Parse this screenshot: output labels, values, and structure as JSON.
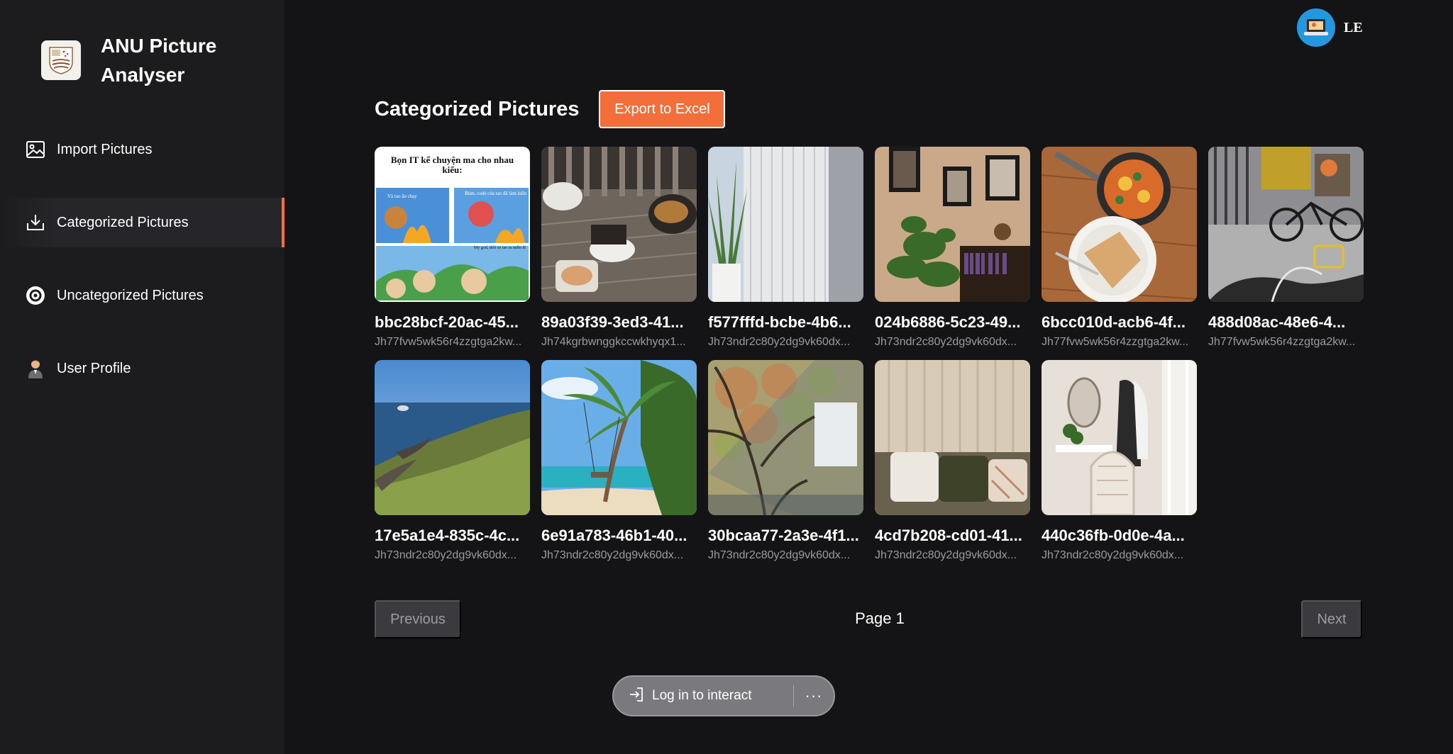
{
  "app": {
    "title": "ANU Picture Analyser"
  },
  "sidebar": {
    "items": [
      {
        "label": "Import Pictures",
        "icon": "image-icon"
      },
      {
        "label": "Categorized Pictures",
        "icon": "download-icon"
      },
      {
        "label": "Uncategorized Pictures",
        "icon": "circle-record-icon"
      },
      {
        "label": "User Profile",
        "icon": "user-icon"
      }
    ]
  },
  "user": {
    "initials": "LE"
  },
  "main": {
    "title": "Categorized Pictures",
    "export_label": "Export to Excel"
  },
  "pictures": [
    {
      "name": "bbc28bcf-20ac-45...",
      "sub": "Jh77fvw5wk56r4zzgtga2kw...",
      "comic_title": "Bọn IT kể chuyện ma cho nhau kiểu:",
      "comic_left": "Và tao ăn chạy",
      "comic_right": "Bùm, code của tao đã làm luôn",
      "comic_bottom": "My god, thôi xe tao ra miền đi"
    },
    {
      "name": "89a03f39-3ed3-41...",
      "sub": "Jh74kgrbwnggkccwkhyqx1..."
    },
    {
      "name": "f577fffd-bcbe-4b6...",
      "sub": "Jh73ndr2c80y2dg9vk60dx..."
    },
    {
      "name": "024b6886-5c23-49...",
      "sub": "Jh73ndr2c80y2dg9vk60dx..."
    },
    {
      "name": "6bcc010d-acb6-4f...",
      "sub": "Jh77fvw5wk56r4zzgtga2kw..."
    },
    {
      "name": "488d08ac-48e6-4...",
      "sub": "Jh77fvw5wk56r4zzgtga2kw..."
    },
    {
      "name": "17e5a1e4-835c-4c...",
      "sub": "Jh73ndr2c80y2dg9vk60dx..."
    },
    {
      "name": "6e91a783-46b1-40...",
      "sub": "Jh73ndr2c80y2dg9vk60dx..."
    },
    {
      "name": "30bcaa77-2a3e-4f1...",
      "sub": "Jh73ndr2c80y2dg9vk60dx..."
    },
    {
      "name": "4cd7b208-cd01-41...",
      "sub": "Jh73ndr2c80y2dg9vk60dx..."
    },
    {
      "name": "440c36fb-0d0e-4a...",
      "sub": "Jh73ndr2c80y2dg9vk60dx..."
    }
  ],
  "pagination": {
    "previous_label": "Previous",
    "page_label": "Page 1",
    "next_label": "Next"
  },
  "overlay": {
    "login_label": "Log in to interact",
    "more_label": "···"
  },
  "colors": {
    "accent": "#ff6b35",
    "background": "#141416",
    "sidebar": "#1c1c1f"
  }
}
